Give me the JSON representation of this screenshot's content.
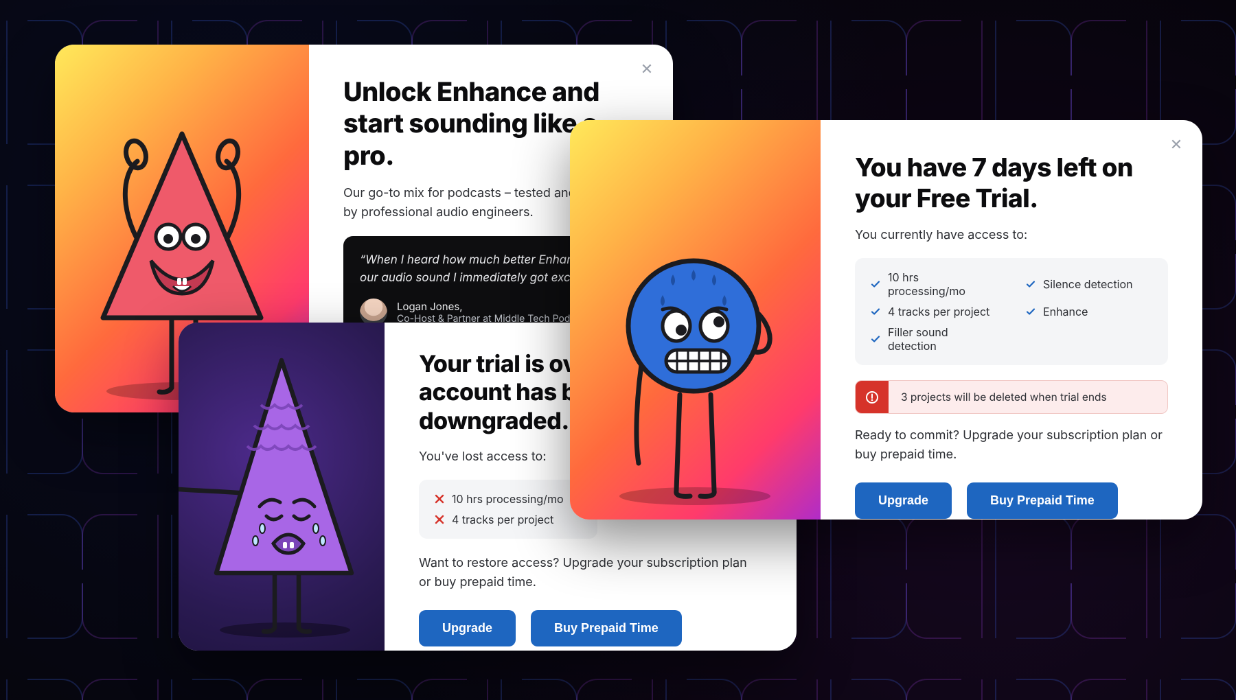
{
  "modals": {
    "unlock": {
      "title": "Unlock Enhance and start sounding like a pro.",
      "lead": "Our go-to mix for podcasts – tested and developed by professional audio engineers.",
      "testimonial": {
        "quote": "“When I heard how much better Enhance made our audio sound I immediately got excited.”",
        "name": "Logan Jones,",
        "role": "Co-Host & Partner at Middle Tech Podcast"
      }
    },
    "over": {
      "title": "Your trial is over and your account has been downgraded.",
      "lost_lead": "You've lost access to:",
      "features": [
        "10 hrs processing/mo",
        "4 tracks per project"
      ],
      "restore_lead": "Want to restore access? Upgrade your subscription plan or buy prepaid time.",
      "upgrade": "Upgrade",
      "prepaid": "Buy Prepaid Time"
    },
    "trial": {
      "title": "You have 7 days left on your Free Trial.",
      "access_lead": "You currently have access to:",
      "features_col1": [
        "10 hrs processing/mo",
        "4 tracks per project",
        "Filler sound detection"
      ],
      "features_col2": [
        "Silence detection",
        "Enhance"
      ],
      "warning": "3 projects will be deleted when trial ends",
      "commit_lead": "Ready to commit? Upgrade your subscription plan or buy prepaid time.",
      "upgrade": "Upgrade",
      "prepaid": "Buy Prepaid Time"
    }
  }
}
